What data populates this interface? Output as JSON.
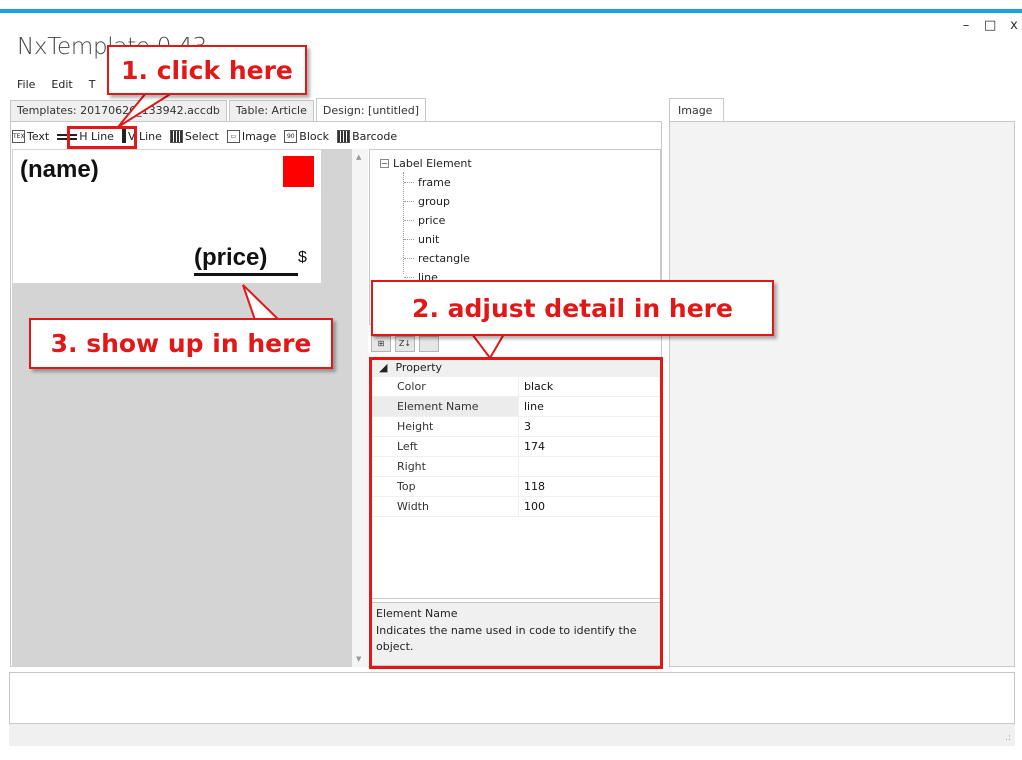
{
  "window": {
    "title": "NxTemplate 0.43",
    "controls": {
      "minimize": "–",
      "maximize": "□",
      "close": "x"
    }
  },
  "menu": {
    "items": [
      "File",
      "Edit",
      "T"
    ]
  },
  "tabs": [
    {
      "label": "Templates: 20170626_133942.accdb",
      "active": false
    },
    {
      "label": "Table: Article",
      "active": false
    },
    {
      "label": "Design: [untitled]",
      "active": true
    }
  ],
  "right_tab": {
    "label": "Image"
  },
  "toolbar": {
    "items": [
      {
        "label": "Text",
        "icon": "text-tool-icon"
      },
      {
        "label": "H Line",
        "icon": "hline-tool-icon"
      },
      {
        "label": "V Line",
        "icon": "vline-tool-icon"
      },
      {
        "label": "Select",
        "icon": "select-tool-icon"
      },
      {
        "label": "Image",
        "icon": "image-tool-icon"
      },
      {
        "label": "Block",
        "icon": "block-tool-icon"
      },
      {
        "label": "Barcode",
        "icon": "barcode-tool-icon"
      }
    ],
    "icon_glyphs": {
      "text": "TEXT",
      "image": "▭",
      "block": "90",
      "barcode": ""
    }
  },
  "canvas": {
    "name_label": "(name)",
    "price_label": "(price)",
    "currency": "$",
    "rect_color": "#ff0000"
  },
  "tree": {
    "root": "Label Element",
    "expander": "−",
    "children": [
      "frame",
      "group",
      "price",
      "unit",
      "rectangle",
      "line"
    ]
  },
  "prop_toolbar": [
    "⊞",
    "Z↓",
    ""
  ],
  "property_grid": {
    "category": "Property",
    "category_glyph": "◢",
    "rows": [
      {
        "key": "Color",
        "value": "black"
      },
      {
        "key": "Element Name",
        "value": "line"
      },
      {
        "key": "Height",
        "value": "3"
      },
      {
        "key": "Left",
        "value": "174"
      },
      {
        "key": "Right",
        "value": ""
      },
      {
        "key": "Top",
        "value": "118"
      },
      {
        "key": "Width",
        "value": "100"
      }
    ]
  },
  "help": {
    "title": "Element Name",
    "description": "Indicates the name used in code to identify the object."
  },
  "scrollbar": {
    "up": "▲",
    "down": "▼"
  },
  "status": {
    "grip": ".:"
  },
  "annotations": {
    "step1": "1. click here",
    "step2": "2. adjust detail in here",
    "step3": "3. show up in here",
    "color": "#e21818"
  }
}
